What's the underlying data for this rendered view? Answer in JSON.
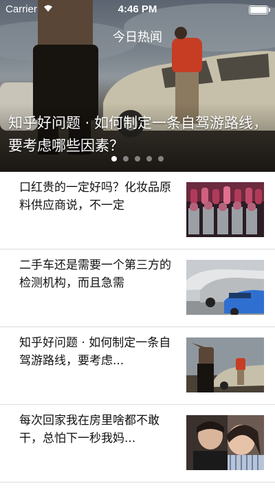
{
  "status_bar": {
    "carrier": "Carrier",
    "time": "4:46 PM",
    "wifi_icon": "wifi-icon",
    "battery_icon": "battery-icon"
  },
  "nav": {
    "title": "今日热闻"
  },
  "banner": {
    "title": "知乎好问题 · 如何制定一条自驾游路线，要考虑哪些因素？",
    "image": "road-trip-car-photo",
    "page_count": 5,
    "active_page": 1
  },
  "news": [
    {
      "title": "口红贵的一定好吗？化妆品原料供应商说，不一定",
      "thumbnail": "lipstick-photo"
    },
    {
      "title": "二手车还是需要一个第三方的检测机构，而且急需",
      "thumbnail": "used-cars-photo"
    },
    {
      "title": "知乎好问题 · 如何制定一条自驾游路线，要考虑...",
      "thumbnail": "road-trip-photo"
    },
    {
      "title": "每次回家我在房里啥都不敢干，总怕下一秒我妈...",
      "thumbnail": "couple-photo"
    }
  ],
  "colors": {
    "text": "#111111",
    "separator": "#dcdcdc",
    "banner_text": "#ffffff"
  }
}
